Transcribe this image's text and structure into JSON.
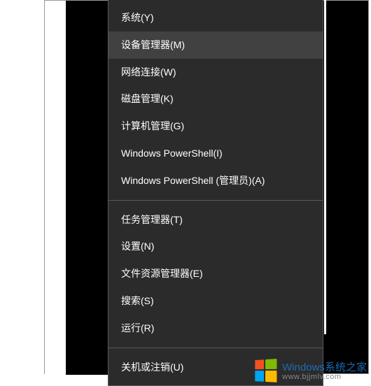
{
  "menu": {
    "sections": [
      {
        "items": [
          {
            "label": "系统(Y)",
            "highlighted": false
          },
          {
            "label": "设备管理器(M)",
            "highlighted": true
          },
          {
            "label": "网络连接(W)",
            "highlighted": false
          },
          {
            "label": "磁盘管理(K)",
            "highlighted": false
          },
          {
            "label": "计算机管理(G)",
            "highlighted": false
          },
          {
            "label": "Windows PowerShell(I)",
            "highlighted": false
          },
          {
            "label": "Windows PowerShell (管理员)(A)",
            "highlighted": false
          }
        ]
      },
      {
        "items": [
          {
            "label": "任务管理器(T)",
            "highlighted": false
          },
          {
            "label": "设置(N)",
            "highlighted": false
          },
          {
            "label": "文件资源管理器(E)",
            "highlighted": false
          },
          {
            "label": "搜索(S)",
            "highlighted": false
          },
          {
            "label": "运行(R)",
            "highlighted": false
          }
        ]
      },
      {
        "items": [
          {
            "label": "关机或注销(U)",
            "highlighted": false
          }
        ]
      }
    ]
  },
  "watermark": {
    "brand": "Windows",
    "subtitle_cn": "系统之家",
    "url": "www.bjjmlv.com"
  }
}
